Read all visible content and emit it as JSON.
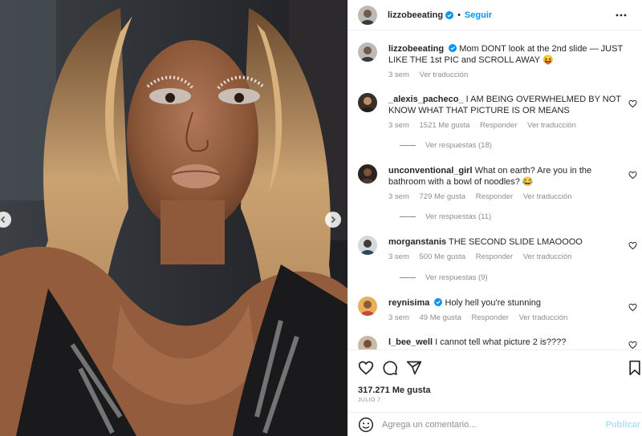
{
  "post": {
    "author": "lizzobeeating",
    "follow_label": "Seguir",
    "caption_author": "lizzobeeating",
    "caption_text": "Mom DONT look at the 2nd slide — JUST LIKE THE 1st PIC and SCROLL AWAY 😝",
    "caption_time": "3 sem",
    "caption_translate": "Ver traducción"
  },
  "comments": [
    {
      "user": "_alexis_pacheco_",
      "text": "I AM BEING OVERWHELMED BY NOT KNOW WHAT THAT PICTURE IS OR MEANS",
      "time": "3 sem",
      "likes": "1521 Me gusta",
      "reply": "Responder",
      "translate": "Ver traducción",
      "replies": "Ver respuestas (18)"
    },
    {
      "user": "unconventional_girl",
      "text": "What on earth? Are you in the bathroom with a bowl of noodles? 😂",
      "time": "3 sem",
      "likes": "729 Me gusta",
      "reply": "Responder",
      "translate": "Ver traducción",
      "replies": "Ver respuestas (11)"
    },
    {
      "user": "morganstanis",
      "text": "THE SECOND SLIDE LMAOOOO",
      "time": "3 sem",
      "likes": "500 Me gusta",
      "reply": "Responder",
      "translate": "Ver traducción",
      "replies": "Ver respuestas (9)"
    },
    {
      "user": "reynisima",
      "text": "Holy hell you're stunning",
      "time": "3 sem",
      "likes": "49 Me gusta",
      "reply": "Responder",
      "translate": "Ver traducción"
    },
    {
      "user": "l_bee_well",
      "text": "I cannot tell what picture 2 is????"
    }
  ],
  "footer": {
    "likes_count": "317.271 Me gusta",
    "date": "JULIO 7",
    "comment_placeholder": "Agrega un comentario...",
    "publish_label": "Publicar"
  },
  "colors": {
    "link": "#0095f6",
    "muted": "#8e8e8e",
    "verified": "#0095f6",
    "publish_disabled": "#b2dffc"
  },
  "icons": [
    "verified-icon",
    "more-options-icon",
    "heart-icon",
    "comment-icon",
    "share-icon",
    "bookmark-icon",
    "emoji-icon",
    "chevron-left-icon",
    "chevron-right-icon"
  ]
}
